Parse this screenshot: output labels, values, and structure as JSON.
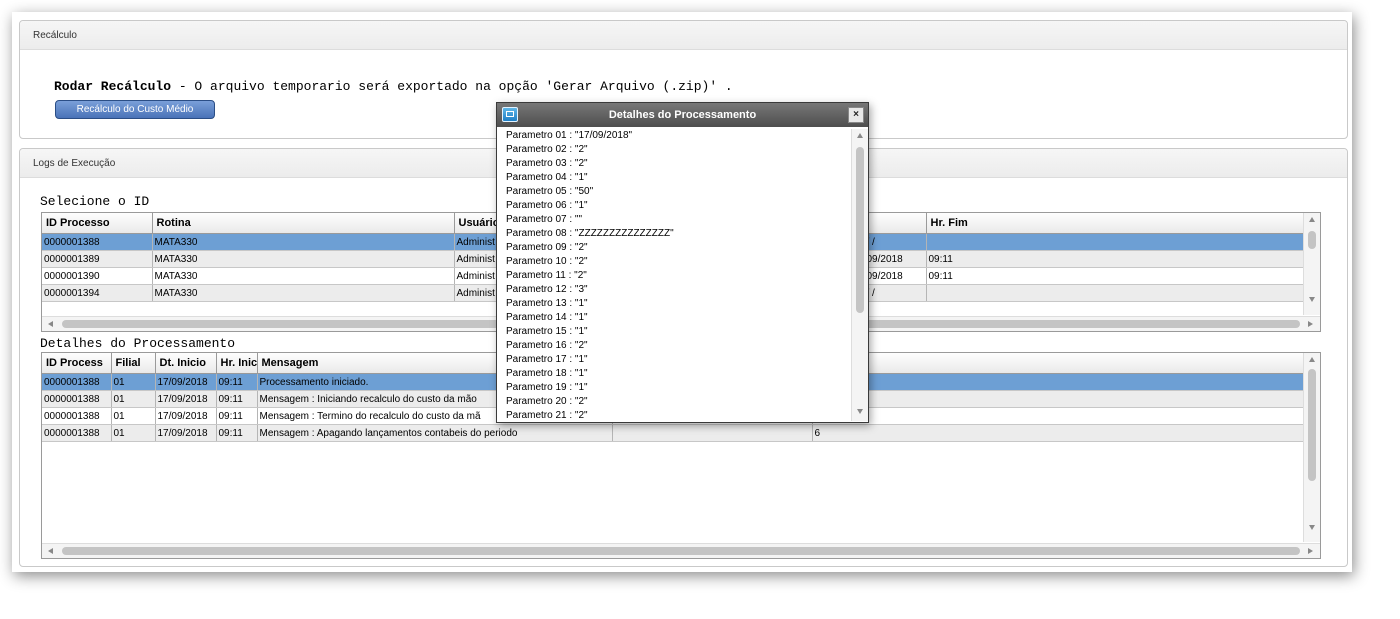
{
  "recalculo": {
    "panel_title": "Recálculo",
    "rodar_label": "Rodar Recálculo",
    "rodar_text": " - O arquivo temporario será exportado na opção 'Gerar Arquivo (.zip)' .",
    "button_label": "Recálculo do Custo Médio"
  },
  "logs": {
    "panel_title": "Logs de Execução",
    "select_id_label": "Selecione o ID",
    "process_columns": [
      "ID Processo",
      "Rotina",
      "Usuário",
      "",
      "Hr. Fim"
    ],
    "process_rows": [
      [
        "0000001388",
        "MATA330",
        "Administ",
        "/ /",
        ""
      ],
      [
        "0000001389",
        "MATA330",
        "Administ",
        "09/2018",
        "09:11"
      ],
      [
        "0000001390",
        "MATA330",
        "Administ",
        "09/2018",
        "09:11"
      ],
      [
        "0000001394",
        "MATA330",
        "Administ",
        "/ /",
        ""
      ]
    ],
    "details_label": "Detalhes do Processamento",
    "detail_columns": [
      "ID Process",
      "Filial",
      "Dt. Inicio",
      "Hr. Inic",
      "Mensagem",
      "",
      ""
    ],
    "detail_rows": [
      [
        "0000001388",
        "01",
        "17/09/2018",
        "09:11",
        "Processamento iniciado.",
        "",
        ""
      ],
      [
        "0000001388",
        "01",
        "17/09/2018",
        "09:11",
        "Mensagem : Iniciando recalculo do custo da mão",
        "",
        ""
      ],
      [
        "0000001388",
        "01",
        "17/09/2018",
        "09:11",
        "Mensagem : Termino do recalculo do custo da mã",
        "",
        ""
      ],
      [
        "0000001388",
        "01",
        "17/09/2018",
        "09:11",
        "Mensagem : Apagando lançamentos contabeis do periodo",
        "",
        "6"
      ]
    ]
  },
  "dialog": {
    "title": "Detalhes do Processamento",
    "close_label": "×",
    "parameters": [
      "Parametro 01 : \"17/09/2018\"",
      "Parametro 02 : \"2\"",
      "Parametro 03 : \"2\"",
      "Parametro 04 : \"1\"",
      "Parametro 05 : \"50\"",
      "Parametro 06 : \"1\"",
      "Parametro 07 : \"\"",
      "Parametro 08 : \"ZZZZZZZZZZZZZZZ\"",
      "Parametro 09 : \"2\"",
      "Parametro 10 : \"2\"",
      "Parametro 11 : \"2\"",
      "Parametro 12 : \"3\"",
      "Parametro 13 : \"1\"",
      "Parametro 14 : \"1\"",
      "Parametro 15 : \"1\"",
      "Parametro 16 : \"2\"",
      "Parametro 17 : \"1\"",
      "Parametro 18 : \"1\"",
      "Parametro 19 : \"1\"",
      "Parametro 20 : \"2\"",
      "Parametro 21 : \"2\""
    ]
  }
}
